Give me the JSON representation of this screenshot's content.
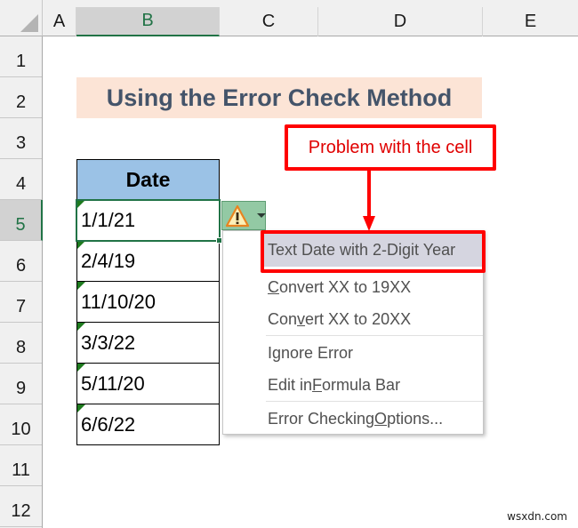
{
  "columns": [
    {
      "label": "A",
      "selected": false
    },
    {
      "label": "B",
      "selected": true
    },
    {
      "label": "C",
      "selected": false
    },
    {
      "label": "D",
      "selected": false
    },
    {
      "label": "E",
      "selected": false
    }
  ],
  "rows": [
    "1",
    "2",
    "3",
    "4",
    "5",
    "6",
    "7",
    "8",
    "9",
    "10",
    "11",
    "12"
  ],
  "selected_row": "5",
  "title": "Using the Error Check Method",
  "table": {
    "header": "Date",
    "cells": [
      "1/1/21",
      "2/4/19",
      "11/10/20",
      "3/3/22",
      "5/11/20",
      "6/6/22"
    ],
    "selected_cell": "B5"
  },
  "smart_tag": {
    "icon": "warning-icon",
    "dropdown": "chevron-down-icon"
  },
  "menu": {
    "items": [
      {
        "label": "Text Date with 2-Digit Year",
        "pre": "Text Date with 2-Digit Year",
        "u": "",
        "post": "",
        "header": true
      },
      {
        "label": "Convert XX to 19XX",
        "pre": "",
        "u": "C",
        "post": "onvert XX to 19XX"
      },
      {
        "label": "Convert XX to 20XX",
        "pre": "Con",
        "u": "v",
        "post": "ert XX to 20XX"
      },
      {
        "label": "Ignore Error",
        "pre": "Ignore Error",
        "u": "",
        "post": ""
      },
      {
        "label": "Edit in Formula Bar",
        "pre": "Edit in ",
        "u": "F",
        "post": "ormula Bar"
      },
      {
        "label": "Error Checking Options...",
        "pre": "Error Checking ",
        "u": "O",
        "post": "ptions..."
      }
    ]
  },
  "callout": {
    "text": "Problem with the cell",
    "color": "#FF0000"
  },
  "colors": {
    "title_bg": "#FCE4D6",
    "title_text": "#44546A",
    "table_header_bg": "#9BC2E6",
    "selection": "#217346",
    "menu_highlight": "#D5D5E0"
  },
  "watermark": "wsxdn.com"
}
